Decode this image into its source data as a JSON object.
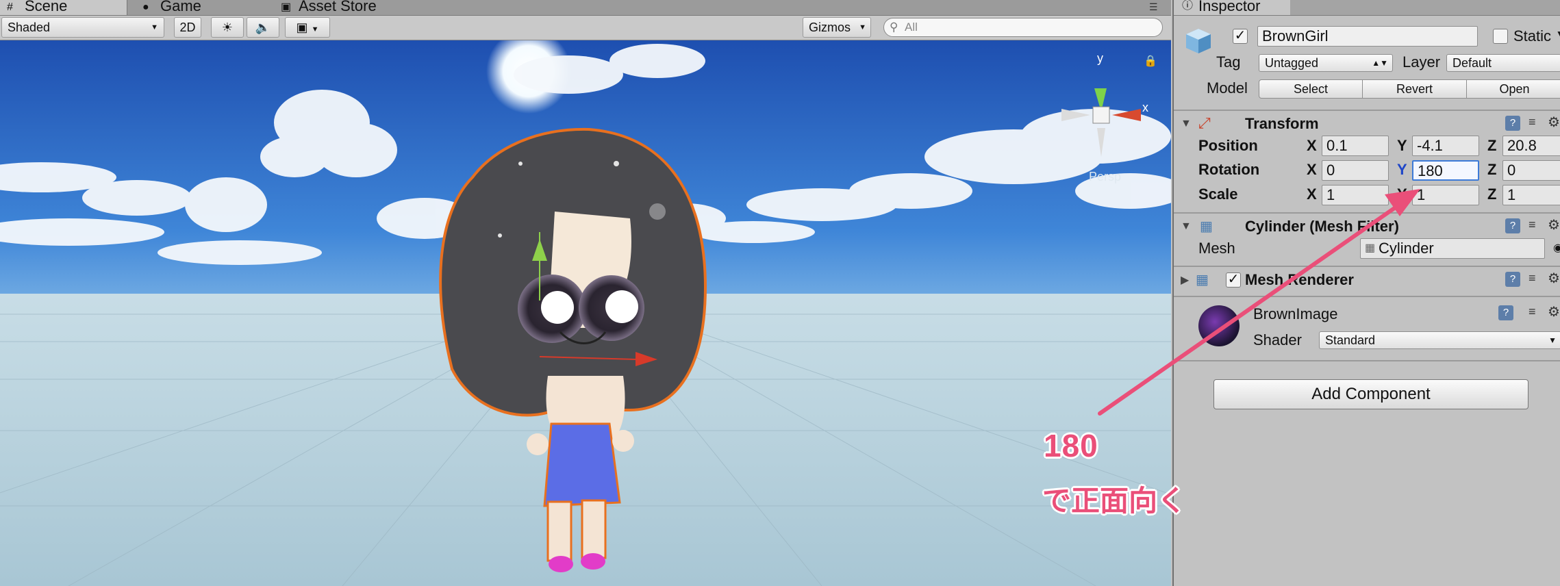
{
  "scene": {
    "tabs": [
      {
        "label": "Scene",
        "icon": "scene-icon"
      },
      {
        "label": "Game",
        "icon": "game-icon"
      },
      {
        "label": "Asset Store",
        "icon": "asset-store-icon"
      }
    ],
    "toolbar": {
      "draw_mode": "Shaded",
      "mode_2d": "2D",
      "gizmos": "Gizmos",
      "search_placeholder": "All"
    },
    "orientation_gizmo": {
      "y": "y",
      "x": "x",
      "projection": "Persp"
    },
    "colors": {
      "sky_top": "#2a63c9",
      "sky_horizon": "#a9d5ef",
      "ground": "#b6d1df"
    }
  },
  "inspector": {
    "tab_label": "Inspector",
    "object_name": "BrownGirl",
    "active": true,
    "static_label": "Static",
    "static_checked": false,
    "tag_label": "Tag",
    "tag_value": "Untagged",
    "layer_label": "Layer",
    "layer_value": "Default",
    "model_label": "Model",
    "model_buttons": [
      "Select",
      "Revert",
      "Open"
    ],
    "transform": {
      "title": "Transform",
      "position": {
        "label": "Position",
        "x": "0.1",
        "y": "-4.1",
        "z": "20.8"
      },
      "rotation": {
        "label": "Rotation",
        "x": "0",
        "y": "180",
        "z": "0"
      },
      "scale": {
        "label": "Scale",
        "x": "1",
        "y": "1",
        "z": "1"
      },
      "axis": {
        "x": "X",
        "y": "Y",
        "z": "Z"
      }
    },
    "mesh_filter": {
      "title": "Cylinder (Mesh Filter)",
      "mesh_label": "Mesh",
      "mesh_value": "Cylinder"
    },
    "mesh_renderer": {
      "title": "Mesh Renderer",
      "enabled": true
    },
    "material": {
      "name": "BrownImage",
      "shader_label": "Shader",
      "shader_value": "Standard"
    },
    "add_component": "Add Component"
  },
  "annotation": {
    "value": "180",
    "text": "で正面向く",
    "color": "#ea4f79"
  }
}
